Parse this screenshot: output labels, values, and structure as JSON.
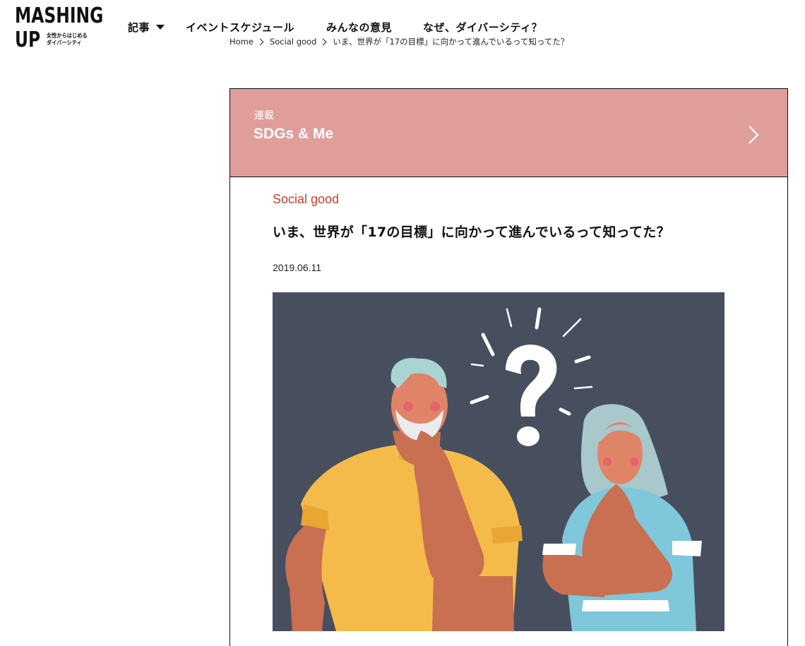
{
  "logo": {
    "line1": "MASHING",
    "line2": "UP",
    "tagline1": "女性からはじめる",
    "tagline2": "ダイバーシティ"
  },
  "nav": {
    "items": [
      {
        "label": "記事"
      },
      {
        "label": "イベントスケジュール"
      },
      {
        "label": "みんなの意見"
      },
      {
        "label": "なぜ、ダイバーシティ？"
      }
    ]
  },
  "breadcrumb": {
    "home": "Home",
    "category": "Social good",
    "current": "いま、世界が「17の目標」に向かって進んでいるって知ってた？"
  },
  "series": {
    "kicker": "連載",
    "title": "SDGs & Me"
  },
  "article": {
    "category": "Social good",
    "title": "いま、世界が「17の目標」に向かって進んでいるって知ってた？",
    "date": "2019.06.11"
  },
  "colors": {
    "series_bg": "#e09e9b",
    "category_red": "#d63b27",
    "hero_bg": "#474f5e"
  }
}
